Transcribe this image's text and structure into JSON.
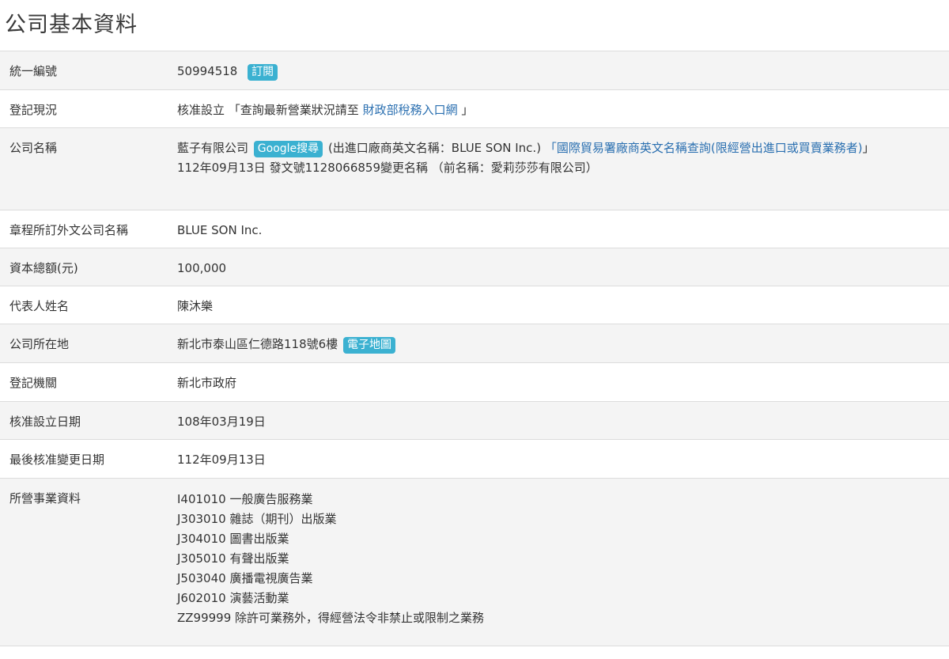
{
  "page": {
    "title": "公司基本資料"
  },
  "rows": {
    "unified_number": {
      "label": "統一編號",
      "value": "50994518",
      "subscribe_button": "訂閱"
    },
    "registration_status": {
      "label": "登記現況",
      "value": "核准設立",
      "query_prefix": " 「查詢最新營業狀況請至 ",
      "tax_link": "財政部稅務入口網",
      "query_suffix": " 」"
    },
    "company_name": {
      "label": "公司名稱",
      "name": "藍子有限公司",
      "google_button": "Google搜尋",
      "english_name_text": "(出進口廠商英文名稱：BLUE SON Inc.)",
      "trade_link_open": "「",
      "trade_link": "國際貿易署廠商英文名稱查詢(限經營出進口或買賣業務者)",
      "trade_link_close": "」",
      "change_note": "112年09月13日 發文號1128066859變更名稱 （前名稱：愛莉莎莎有限公司）"
    },
    "foreign_name": {
      "label": "章程所訂外文公司名稱",
      "value": "BLUE SON Inc."
    },
    "capital": {
      "label": "資本總額(元)",
      "value": "100,000"
    },
    "representative": {
      "label": "代表人姓名",
      "value": "陳沐樂"
    },
    "address": {
      "label": "公司所在地",
      "value": "新北市泰山區仁德路118號6樓",
      "map_button": "電子地圖"
    },
    "authority": {
      "label": "登記機關",
      "value": "新北市政府"
    },
    "approval_date": {
      "label": "核准設立日期",
      "value": "108年03月19日"
    },
    "last_change_date": {
      "label": "最後核准變更日期",
      "value": "112年09月13日"
    },
    "business_items": {
      "label": "所營事業資料",
      "items": [
        "I401010 一般廣告服務業",
        "J303010 雜誌（期刊）出版業",
        "J304010 圖書出版業",
        "J305010 有聲出版業",
        "J503040 廣播電視廣告業",
        "J602010 演藝活動業",
        "ZZ99999 除許可業務外，得經營法令非禁止或限制之業務"
      ]
    }
  },
  "colors": {
    "badge": "#3bb1d1",
    "link": "#2a6fb0",
    "row_alt": "#f4f4f4",
    "border": "#dcdcdc"
  }
}
